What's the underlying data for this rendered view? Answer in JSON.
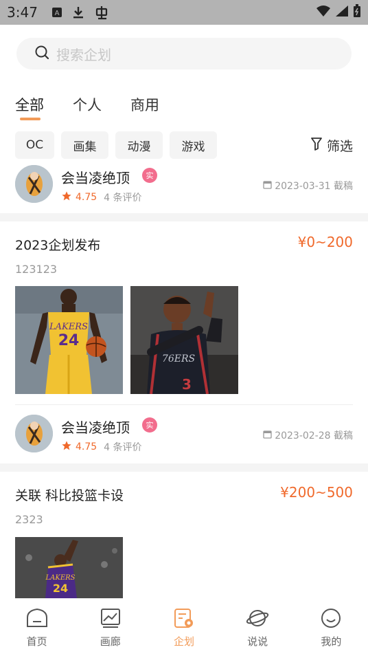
{
  "status_bar": {
    "time": "3:47"
  },
  "search": {
    "placeholder": "搜索企划"
  },
  "tabs": [
    {
      "label": "全部"
    },
    {
      "label": "个人"
    },
    {
      "label": "商用"
    }
  ],
  "chips": [
    {
      "label": "OC"
    },
    {
      "label": "画集"
    },
    {
      "label": "动漫"
    },
    {
      "label": "游戏"
    }
  ],
  "filter": {
    "label": "筛选"
  },
  "users": [
    {
      "name": "会当凌绝顶",
      "badge": "实",
      "score": "4.75",
      "reviews": "4 条评价",
      "date": "2023-03-31 截稿"
    },
    {
      "name": "会当凌绝顶",
      "badge": "实",
      "score": "4.75",
      "reviews": "4 条评价",
      "date": "2023-02-28 截稿"
    }
  ],
  "posts": [
    {
      "title": "2023企划发布",
      "price": "¥0~200",
      "desc": "123123"
    },
    {
      "title": "关联 科比投篮卡设",
      "price": "¥200~500",
      "desc": "2323"
    }
  ],
  "bottom_nav": [
    {
      "label": "首页",
      "icon": "home-icon"
    },
    {
      "label": "画廊",
      "icon": "gallery-icon"
    },
    {
      "label": "企划",
      "icon": "plan-icon"
    },
    {
      "label": "说说",
      "icon": "planet-icon"
    },
    {
      "label": "我的",
      "icon": "smile-icon"
    }
  ],
  "colors": {
    "accent": "#f29b58",
    "price": "#f0692b",
    "badge": "#f26d8d",
    "status_bar": "#b3b3b3"
  }
}
